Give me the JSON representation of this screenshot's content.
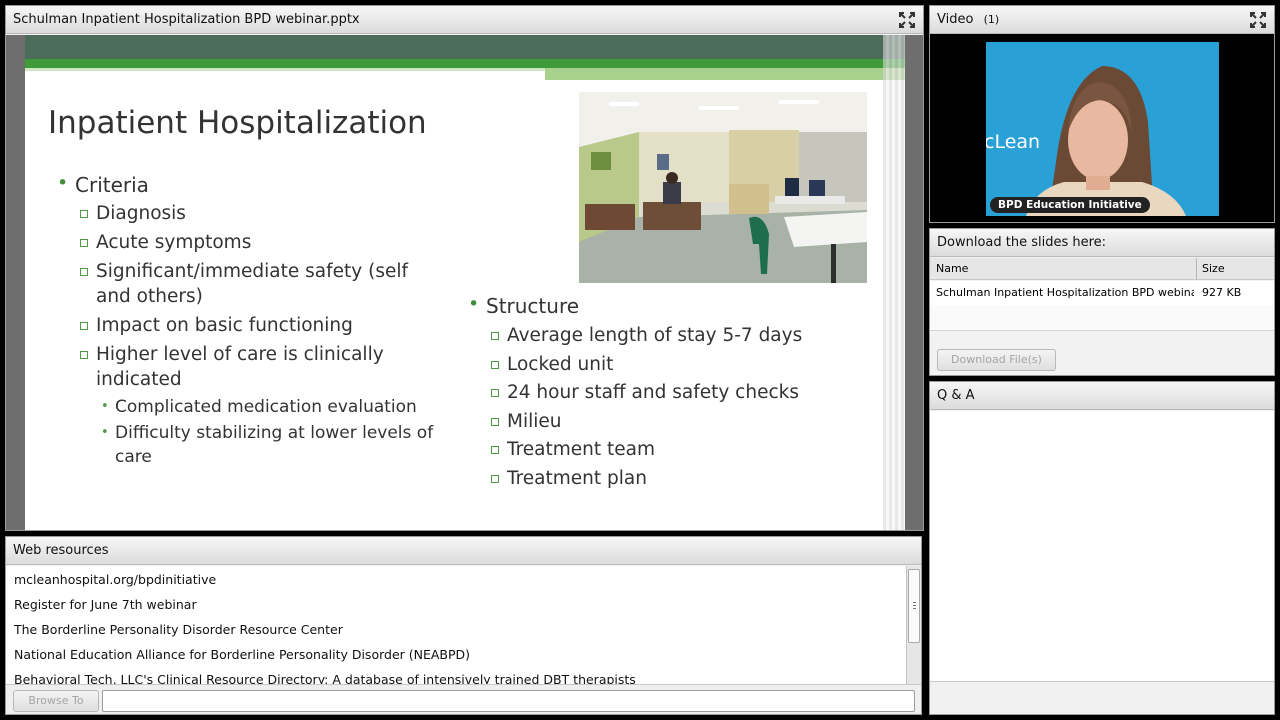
{
  "share_pod": {
    "title": "Schulman Inpatient Hospitalization BPD webinar.pptx"
  },
  "slide": {
    "title": "Inpatient Hospitalization",
    "left": {
      "heading": "Criteria",
      "items": [
        "Diagnosis",
        "Acute symptoms",
        "Significant/immediate safety (self",
        "and others)",
        "Impact on basic functioning",
        "Higher level of care is clinically",
        "indicated"
      ],
      "subitems": [
        "Complicated medication evaluation",
        "Difficulty stabilizing at lower levels of",
        "care"
      ]
    },
    "right": {
      "heading": "Structure",
      "items": [
        "Average length of stay 5-7 days",
        "Locked unit",
        "24 hour staff and safety checks",
        "Milieu",
        "Treatment team",
        "Treatment plan"
      ]
    }
  },
  "video_pod": {
    "title": "Video",
    "count": "(1)",
    "tag": "BPD Education Initiative",
    "backdrop_text": "cLean"
  },
  "files_pod": {
    "title": "Download the slides here:",
    "columns": [
      "Name",
      "Size"
    ],
    "rows": [
      {
        "name": "Schulman Inpatient Hospitalization BPD webinar.pptx",
        "size": "927 KB"
      }
    ],
    "button": "Download File(s)"
  },
  "qa_pod": {
    "title": "Q & A"
  },
  "web_pod": {
    "title": "Web resources",
    "links": [
      "mcleanhospital.org/bpdinitiative",
      "Register for June 7th webinar",
      "The Borderline Personality Disorder Resource Center",
      "National Education Alliance for Borderline Personality Disorder (NEABPD)",
      "Behavioral Tech, LLC's Clinical Resource Directory: A database of intensively trained DBT therapists"
    ],
    "browse_button": "Browse To"
  },
  "colors": {
    "slide_green_dark": "#4c6b58",
    "slide_green": "#3f9a3a",
    "slide_green_light": "#a9d18e",
    "video_bg": "#2aa1d6"
  }
}
